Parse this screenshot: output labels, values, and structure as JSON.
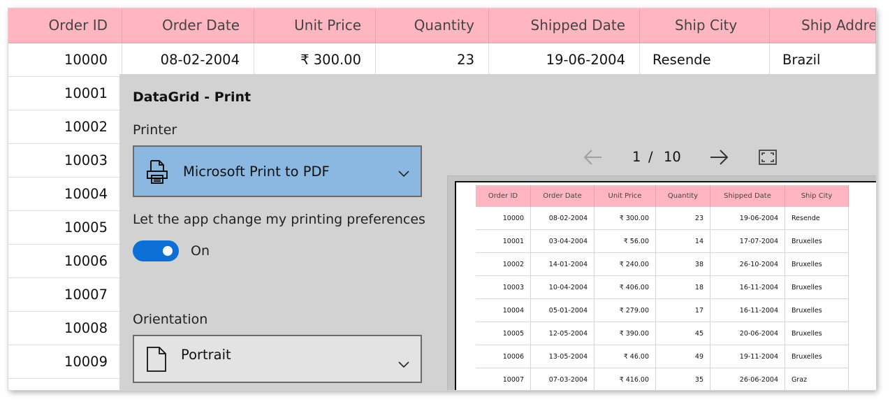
{
  "grid": {
    "columns": [
      "Order ID",
      "Order Date",
      "Unit Price",
      "Quantity",
      "Shipped Date",
      "Ship City",
      "Ship Address"
    ],
    "first_row": [
      "10000",
      "08-02-2004",
      "₹ 300.00",
      "23",
      "19-06-2004",
      "Resende",
      "Brazil"
    ],
    "order_ids": [
      "10001",
      "10002",
      "10003",
      "10004",
      "10005",
      "10006",
      "10007",
      "10008",
      "10009"
    ]
  },
  "dialog": {
    "title": "DataGrid - Print",
    "printer_label": "Printer",
    "printer_value": "Microsoft Print to PDF",
    "preferences_label": "Let the app change my printing preferences",
    "toggle_state": "On",
    "orientation_label": "Orientation",
    "orientation_value": "Portrait",
    "page_current": "1",
    "page_separator": "/",
    "page_total": "10"
  },
  "preview": {
    "columns": [
      "Order ID",
      "Order Date",
      "Unit Price",
      "Quantity",
      "Shipped Date",
      "Ship City"
    ],
    "rows": [
      [
        "10000",
        "08-02-2004",
        "₹ 300.00",
        "23",
        "19-06-2004",
        "Resende"
      ],
      [
        "10001",
        "03-04-2004",
        "₹ 56.00",
        "14",
        "17-07-2004",
        "Bruxelles"
      ],
      [
        "10002",
        "14-01-2004",
        "₹ 240.00",
        "38",
        "26-10-2004",
        "Bruxelles"
      ],
      [
        "10003",
        "10-04-2004",
        "₹ 406.00",
        "18",
        "16-11-2004",
        "Bruxelles"
      ],
      [
        "10004",
        "05-01-2004",
        "₹ 279.00",
        "17",
        "16-11-2004",
        "Bruxelles"
      ],
      [
        "10005",
        "12-05-2004",
        "₹ 390.00",
        "45",
        "20-06-2004",
        "Bruxelles"
      ],
      [
        "10006",
        "13-05-2004",
        "₹ 46.00",
        "49",
        "19-11-2004",
        "Bruxelles"
      ],
      [
        "10007",
        "07-03-2004",
        "₹ 416.00",
        "35",
        "26-06-2004",
        "Graz"
      ]
    ]
  },
  "colors": {
    "header_pink": "#ffb6c1",
    "printer_select_bg": "#8ab8e0",
    "toggle_on": "#0b6fd6",
    "dialog_bg": "#d2d2d2"
  },
  "icons": {
    "printer": "printer-icon",
    "orientation": "page-icon",
    "dropdown": "chevron-down-icon",
    "prev": "arrow-left-icon",
    "next": "arrow-right-icon",
    "fit": "fullscreen-icon"
  }
}
